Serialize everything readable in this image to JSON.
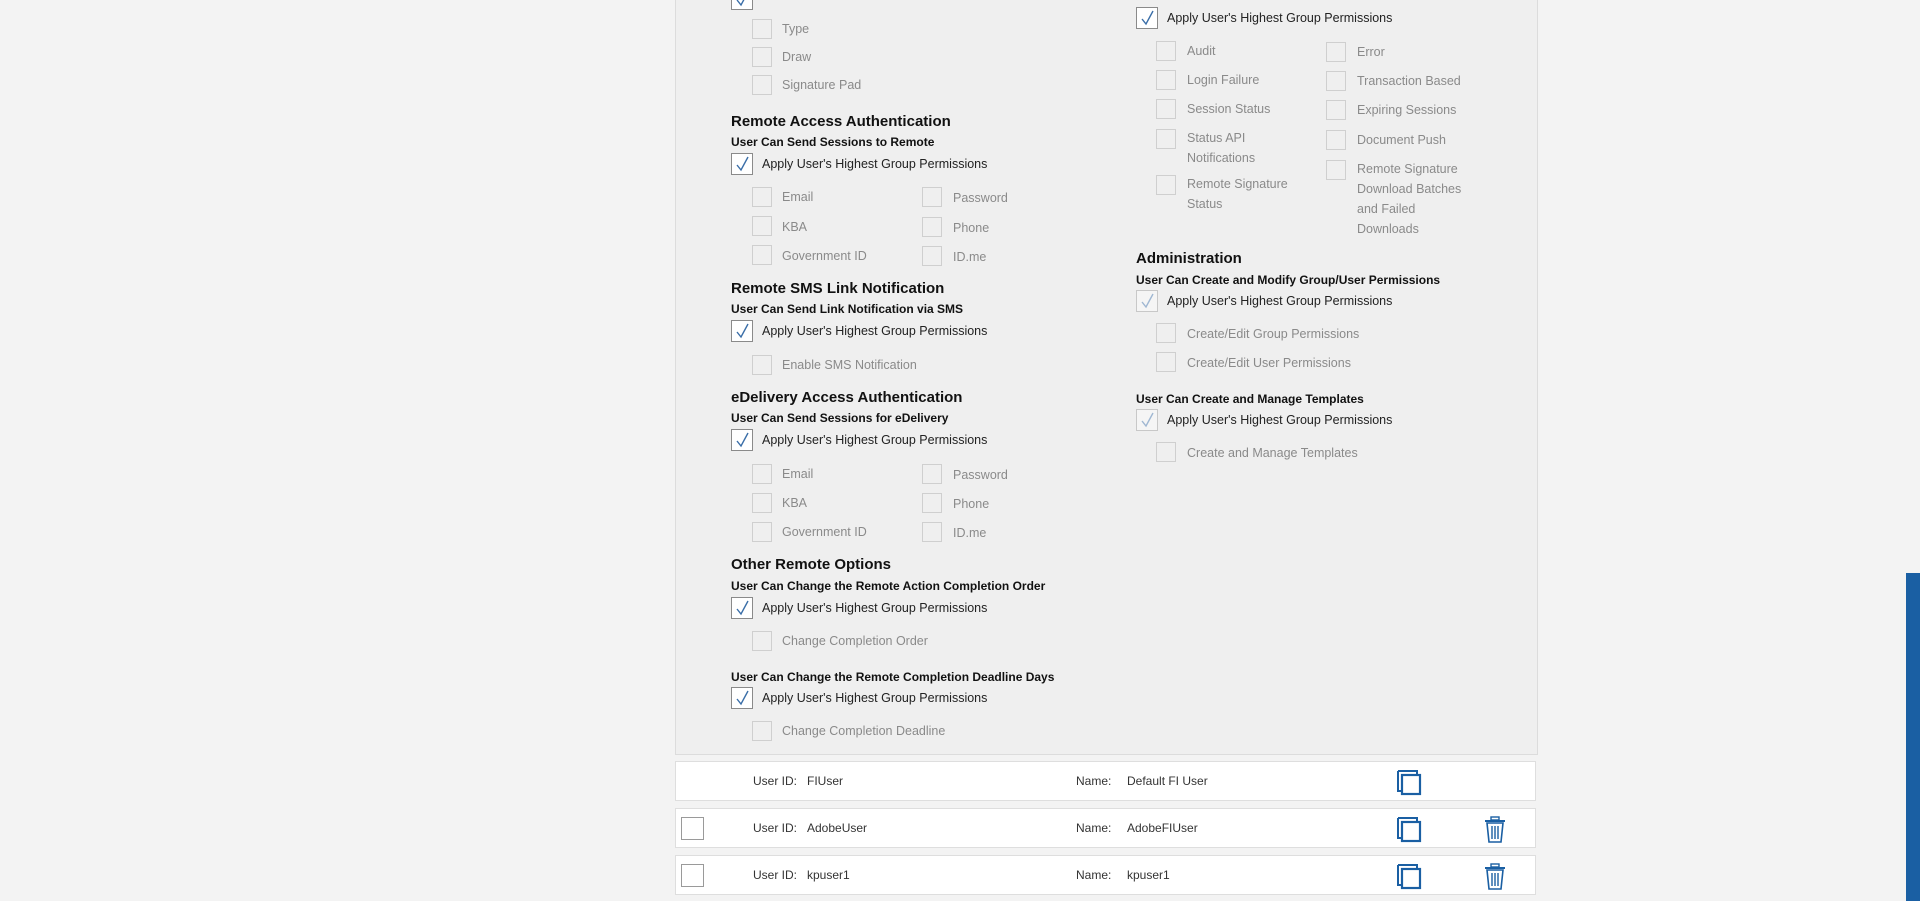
{
  "colors": {
    "accent": "#1a5fa3",
    "check": "#3a6ea8"
  },
  "left": {
    "signature_options": [
      "Type",
      "Draw",
      "Signature Pad"
    ],
    "remote_access": {
      "title": "Remote Access Authentication",
      "subtitle": "User Can Send Sessions to Remote",
      "apply_label": "Apply User's Highest Group Permissions",
      "options_col1": [
        "Email",
        "KBA",
        "Government ID"
      ],
      "options_col2": [
        "Password",
        "Phone",
        "ID.me"
      ]
    },
    "remote_sms": {
      "title": "Remote SMS Link Notification",
      "subtitle": "User Can Send Link Notification via SMS",
      "apply_label": "Apply User's Highest Group Permissions",
      "option": "Enable SMS Notification"
    },
    "edelivery": {
      "title": "eDelivery Access Authentication",
      "subtitle": "User Can Send Sessions for eDelivery",
      "apply_label": "Apply User's Highest Group Permissions",
      "options_col1": [
        "Email",
        "KBA",
        "Government ID"
      ],
      "options_col2": [
        "Password",
        "Phone",
        "ID.me"
      ]
    },
    "other_remote": {
      "title": "Other Remote Options",
      "subtitle1": "User Can Change the Remote Action Completion Order",
      "apply_label1": "Apply User's Highest Group Permissions",
      "option1": "Change Completion Order",
      "subtitle2": "User Can Change the Remote Completion Deadline Days",
      "apply_label2": "Apply User's Highest Group Permissions",
      "option2": "Change Completion Deadline"
    }
  },
  "right": {
    "reports": {
      "apply_label": "Apply User's Highest Group Permissions",
      "options_col1": [
        "Audit",
        "Login Failure",
        "Session Status",
        "Status API Notifications",
        "Remote Signature Status"
      ],
      "options_col2": [
        "Error",
        "Transaction Based",
        "Expiring Sessions",
        "Document Push",
        "Remote Signature Download Batches and Failed Downloads"
      ]
    },
    "administration": {
      "title": "Administration",
      "subtitle1": "User Can Create and Modify Group/User Permissions",
      "apply_label1": "Apply User's Highest Group Permissions",
      "options1": [
        "Create/Edit Group Permissions",
        "Create/Edit User Permissions"
      ],
      "subtitle2": "User Can Create and Manage Templates",
      "apply_label2": "Apply User's Highest Group Permissions",
      "option2": "Create and Manage Templates"
    }
  },
  "users": {
    "user_id_caption": "User ID:",
    "name_caption": "Name:",
    "rows": [
      {
        "user_id": "FIUser",
        "name": "Default FI User"
      },
      {
        "user_id": "AdobeUser",
        "name": "AdobeFIUser"
      },
      {
        "user_id": "kpuser1",
        "name": "kpuser1"
      }
    ]
  }
}
